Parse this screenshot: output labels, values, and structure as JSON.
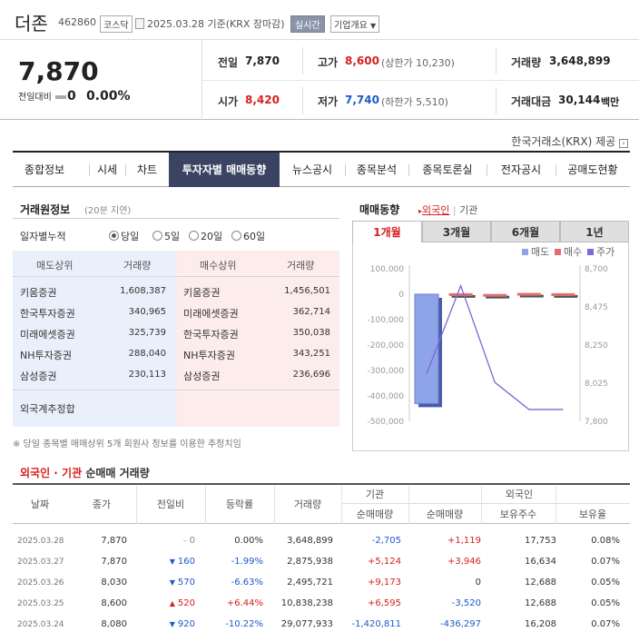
{
  "header": {
    "name": "더존",
    "code": "462860",
    "market_badge": "코스닥",
    "date_text": "2025.03.28  기준(KRX 장마감)",
    "realtime_label": "실시간",
    "company_button": "기업개요"
  },
  "price": {
    "current": "7,870",
    "change_label": "전일대비",
    "change": "0",
    "change_pct": "0.00%"
  },
  "summary": {
    "prev_label": "전일",
    "prev": "7,870",
    "high_label": "고가",
    "high": "8,600",
    "upper": "(상한가 10,230)",
    "volume_label": "거래량",
    "volume": "3,648,899",
    "open_label": "시가",
    "open": "8,420",
    "low_label": "저가",
    "low": "7,740",
    "lower": "(하한가 5,510)",
    "amount_label": "거래대금",
    "amount": "30,144",
    "amount_unit": "백만"
  },
  "krx_note": "한국거래소(KRX) 제공",
  "tabs": [
    "종합정보",
    "시세",
    "차트",
    "투자자별 매매동향",
    "뉴스공시",
    "종목분석",
    "종목토론실",
    "전자공시",
    "공매도현황"
  ],
  "broker": {
    "title": "거래원정보",
    "delay": "(20분 지연)",
    "period_label": "일자별누적",
    "periods": [
      "당일",
      "5일",
      "20일",
      "60일"
    ],
    "sell_header": "매도상위",
    "buy_header": "매수상위",
    "vol_header": "거래량",
    "sell": [
      {
        "name": "키움증권",
        "vol": "1,608,387"
      },
      {
        "name": "한국투자증권",
        "vol": "340,965"
      },
      {
        "name": "미래에셋증권",
        "vol": "325,739"
      },
      {
        "name": "NH투자증권",
        "vol": "288,040"
      },
      {
        "name": "삼성증권",
        "vol": "230,113"
      }
    ],
    "buy": [
      {
        "name": "키움증권",
        "vol": "1,456,501"
      },
      {
        "name": "미래에셋증권",
        "vol": "362,714"
      },
      {
        "name": "한국투자증권",
        "vol": "350,038"
      },
      {
        "name": "NH투자증권",
        "vol": "343,251"
      },
      {
        "name": "삼성증권",
        "vol": "236,696"
      }
    ],
    "foreign_label": "외국계추정합",
    "footnote": "※ 당일 종목별 매매상위 5개 회원사 정보를 이용한 추정치임"
  },
  "trend": {
    "title": "매매동향",
    "filter_foreign": "외국인",
    "filter_inst": "기관",
    "periods": [
      "1개월",
      "3개월",
      "6개월",
      "1년"
    ]
  },
  "chart_data": {
    "type": "bar",
    "legend": [
      "매도",
      "매수",
      "주가"
    ],
    "colors": {
      "sell": "#8ea4e8",
      "buy": "#e07070",
      "price": "#7b68d9"
    },
    "y_left_ticks": [
      "100,000",
      "0",
      "-100,000",
      "-200,000",
      "-300,000",
      "-400,000",
      "-500,000"
    ],
    "y_left_range": [
      -500000,
      100000
    ],
    "y_right_ticks": [
      "8,700",
      "8,475",
      "8,250",
      "8,025",
      "7,800"
    ],
    "y_right_range": [
      7800,
      8700
    ],
    "bars": [
      -430000,
      3946,
      1119,
      5124,
      3946
    ],
    "price": [
      8080,
      8600,
      8030,
      7870,
      7870
    ]
  },
  "table": {
    "title_prefix": "외국인 · 기관",
    "title_suffix": "순매매 거래량",
    "headers": {
      "date": "날짜",
      "close": "종가",
      "change": "전일비",
      "rate": "등락률",
      "volume": "거래량",
      "inst": "기관",
      "foreign": "외국인",
      "inst_net": "순매매량",
      "for_net": "순매매량",
      "for_hold": "보유주수",
      "for_ratio": "보유율"
    },
    "rows": [
      {
        "date": "2025.03.28",
        "close": "7,870",
        "dir": "flat",
        "change": "0",
        "rate": "0.00%",
        "volume": "3,648,899",
        "inst": "-2,705",
        "foreign": "+1,119",
        "hold": "17,753",
        "ratio": "0.08%"
      },
      {
        "date": "2025.03.27",
        "close": "7,870",
        "dir": "down",
        "change": "160",
        "rate": "-1.99%",
        "volume": "2,875,938",
        "inst": "+5,124",
        "foreign": "+3,946",
        "hold": "16,634",
        "ratio": "0.07%"
      },
      {
        "date": "2025.03.26",
        "close": "8,030",
        "dir": "down",
        "change": "570",
        "rate": "-6.63%",
        "volume": "2,495,721",
        "inst": "+9,173",
        "foreign": "0",
        "hold": "12,688",
        "ratio": "0.05%"
      },
      {
        "date": "2025.03.25",
        "close": "8,600",
        "dir": "up",
        "change": "520",
        "rate": "+6.44%",
        "volume": "10,838,238",
        "inst": "+6,595",
        "foreign": "-3,520",
        "hold": "12,688",
        "ratio": "0.05%"
      },
      {
        "date": "2025.03.24",
        "close": "8,080",
        "dir": "down",
        "change": "920",
        "rate": "-10.22%",
        "volume": "29,077,933",
        "inst": "-1,420,811",
        "foreign": "-436,297",
        "hold": "16,208",
        "ratio": "0.07%"
      }
    ]
  }
}
